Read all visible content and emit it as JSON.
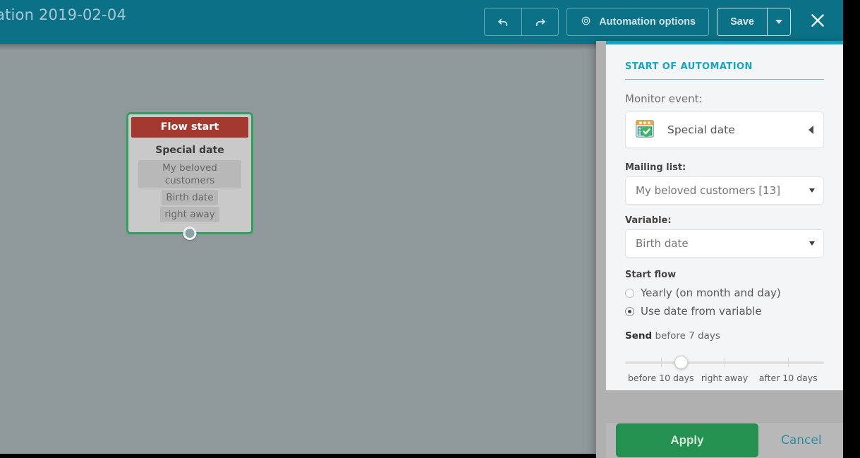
{
  "header": {
    "title": "ation 2019-02-04",
    "toolbar": {
      "undo_icon": "undo-arrow-icon",
      "redo_icon": "redo-arrow-icon",
      "automation_options_label": "Automation options",
      "automation_options_icon": "gear-icon",
      "save_label": "Save",
      "save_caret_icon": "chevron-down-icon",
      "close_icon": "close-x-icon"
    },
    "background_color": "#0b7186"
  },
  "canvas": {
    "background_color": "#8f989b",
    "node": {
      "header_label": "Flow start",
      "header_color": "#a3382f",
      "border_color": "#2aa35c",
      "title": "Special date",
      "tags": [
        "My beloved customers",
        "Birth date",
        "right away"
      ],
      "connector_icon": "connector-dot-icon"
    }
  },
  "panel": {
    "heading": "START OF AUTOMATION",
    "accent_color": "#15a3bf",
    "monitor_event": {
      "label": "Monitor event:",
      "value": "Special date",
      "icon": "calendar-check-icon",
      "expand_icon": "triangle-left-icon"
    },
    "mailing_list": {
      "label": "Mailing list:",
      "value": "My beloved customers [13]"
    },
    "variable": {
      "label": "Variable:",
      "value": "Birth date"
    },
    "start_flow": {
      "label": "Start flow",
      "options": [
        {
          "label": "Yearly (on month and day)",
          "selected": false
        },
        {
          "label": "Use date from variable",
          "selected": true
        }
      ]
    },
    "send": {
      "prefix": "Send",
      "value_text": "before 7 days",
      "slider": {
        "min_label": "before 10 days",
        "mid_label": "right away",
        "max_label": "after 10 days",
        "handle_percent": 28
      }
    },
    "footer": {
      "apply_label": "Apply",
      "apply_color": "#259150",
      "cancel_label": "Cancel",
      "cancel_color": "#2a8ca3"
    }
  }
}
